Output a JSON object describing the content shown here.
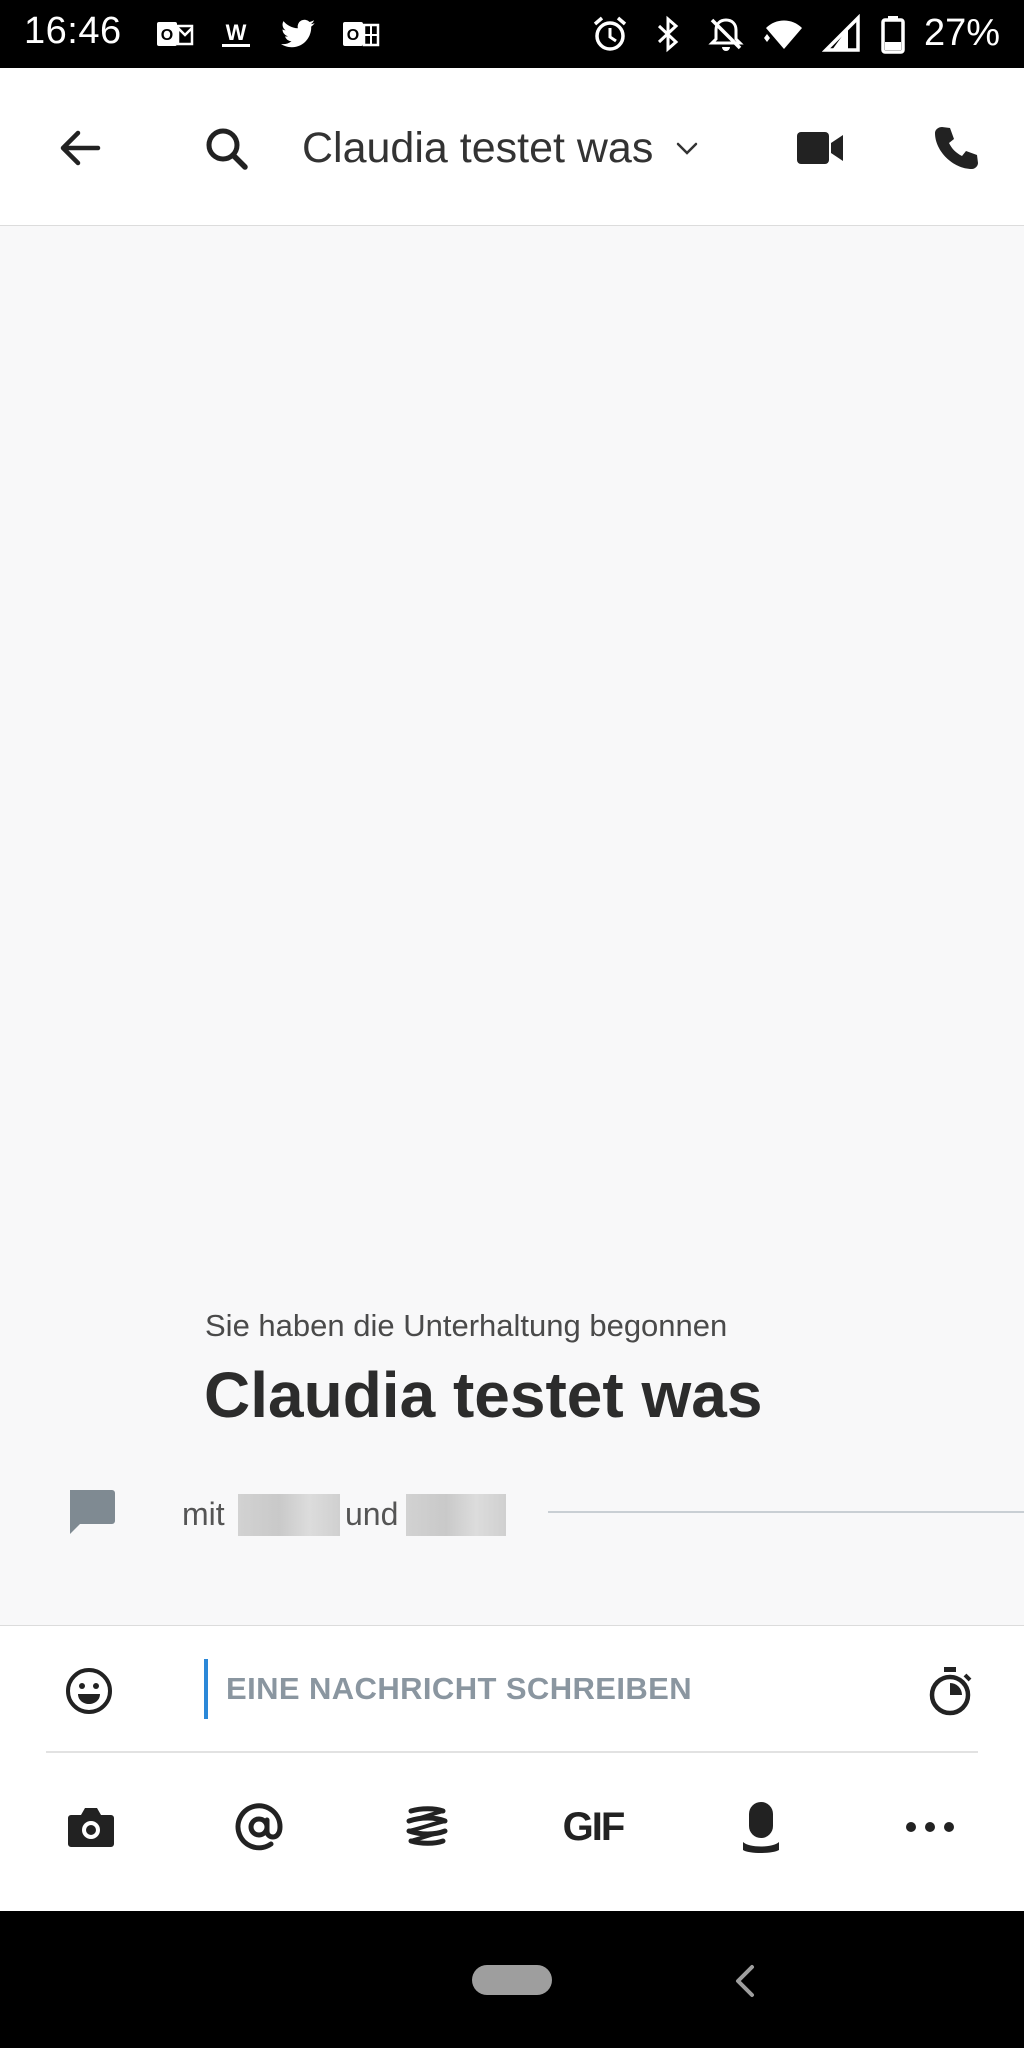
{
  "status_bar": {
    "time": "16:46",
    "battery_text": "27%",
    "notification_icons": [
      "outlook-icon",
      "word-icon",
      "twitter-icon",
      "office-icon"
    ],
    "system_icons": [
      "alarm-icon",
      "bluetooth-icon",
      "dnd-icon",
      "wifi-icon",
      "signal-icon",
      "battery-icon"
    ]
  },
  "header": {
    "title": "Claudia testet was"
  },
  "conversation": {
    "started_text": "Sie haben die Unterhaltung begonnen",
    "title": "Claudia testet was",
    "mit_label": "mit",
    "und_label": "und"
  },
  "composer": {
    "placeholder": "EINE NACHRICHT SCHREIBEN",
    "value": "",
    "gif_label": "GIF"
  },
  "colors": {
    "accent": "#2b88d8",
    "background": "#f8f8f9",
    "header": "#ffffff",
    "icon": "#222222"
  }
}
